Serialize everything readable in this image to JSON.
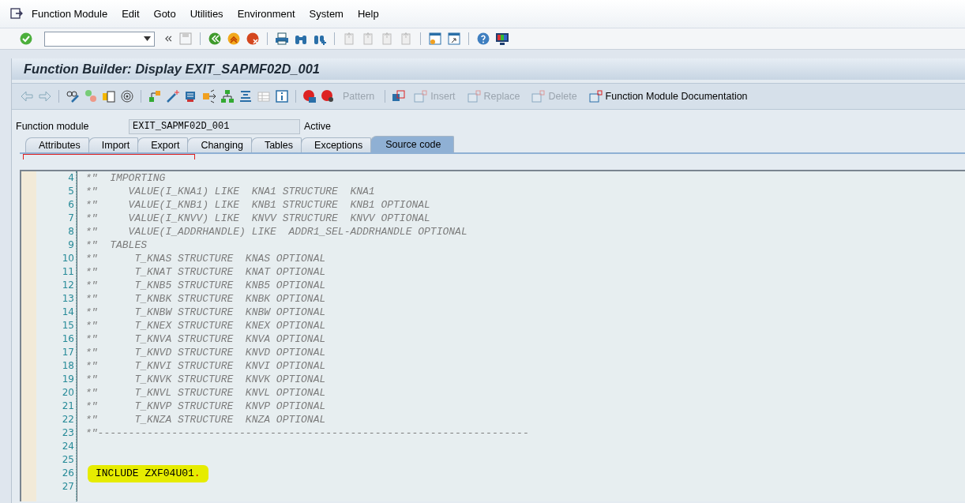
{
  "menu": [
    {
      "label": "Function Module"
    },
    {
      "label": "Edit"
    },
    {
      "label": "Goto"
    },
    {
      "label": "Utilities"
    },
    {
      "label": "Environment"
    },
    {
      "label": "System"
    },
    {
      "label": "Help"
    }
  ],
  "title": "Function Builder: Display EXIT_SAPMF02D_001",
  "app_toolbar": [
    {
      "label": "Pattern",
      "disabled": true
    },
    {
      "label": "Insert",
      "disabled": true
    },
    {
      "label": "Replace",
      "disabled": true
    },
    {
      "label": "Delete",
      "disabled": true
    },
    {
      "label": "Function Module Documentation",
      "disabled": false
    }
  ],
  "field": {
    "label": "Function module",
    "value": "EXIT_SAPMF02D_001",
    "status": "Active"
  },
  "tabs": [
    {
      "label": "Attributes",
      "selected": false
    },
    {
      "label": "Import",
      "selected": false
    },
    {
      "label": "Export",
      "selected": false
    },
    {
      "label": "Changing",
      "selected": false
    },
    {
      "label": "Tables",
      "selected": false
    },
    {
      "label": "Exceptions",
      "selected": false
    },
    {
      "label": "Source code",
      "selected": true
    }
  ],
  "editor": {
    "lines": [
      {
        "number": "4",
        "kind": "comment",
        "text": "*\"  IMPORTING"
      },
      {
        "number": "5",
        "kind": "comment",
        "text": "*\"     VALUE(I_KNA1) LIKE  KNA1 STRUCTURE  KNA1"
      },
      {
        "number": "6",
        "kind": "comment",
        "text": "*\"     VALUE(I_KNB1) LIKE  KNB1 STRUCTURE  KNB1 OPTIONAL"
      },
      {
        "number": "7",
        "kind": "comment",
        "text": "*\"     VALUE(I_KNVV) LIKE  KNVV STRUCTURE  KNVV OPTIONAL"
      },
      {
        "number": "8",
        "kind": "comment",
        "text": "*\"     VALUE(I_ADDRHANDLE) LIKE  ADDR1_SEL-ADDRHANDLE OPTIONAL"
      },
      {
        "number": "9",
        "kind": "comment",
        "text": "*\"  TABLES"
      },
      {
        "number": "10",
        "kind": "comment",
        "text": "*\"      T_KNAS STRUCTURE  KNAS OPTIONAL"
      },
      {
        "number": "11",
        "kind": "comment",
        "text": "*\"      T_KNAT STRUCTURE  KNAT OPTIONAL"
      },
      {
        "number": "12",
        "kind": "comment",
        "text": "*\"      T_KNB5 STRUCTURE  KNB5 OPTIONAL"
      },
      {
        "number": "13",
        "kind": "comment",
        "text": "*\"      T_KNBK STRUCTURE  KNBK OPTIONAL"
      },
      {
        "number": "14",
        "kind": "comment",
        "text": "*\"      T_KNBW STRUCTURE  KNBW OPTIONAL"
      },
      {
        "number": "15",
        "kind": "comment",
        "text": "*\"      T_KNEX STRUCTURE  KNEX OPTIONAL"
      },
      {
        "number": "16",
        "kind": "comment",
        "text": "*\"      T_KNVA STRUCTURE  KNVA OPTIONAL"
      },
      {
        "number": "17",
        "kind": "comment",
        "text": "*\"      T_KNVD STRUCTURE  KNVD OPTIONAL"
      },
      {
        "number": "18",
        "kind": "comment",
        "text": "*\"      T_KNVI STRUCTURE  KNVI OPTIONAL"
      },
      {
        "number": "19",
        "kind": "comment",
        "text": "*\"      T_KNVK STRUCTURE  KNVK OPTIONAL"
      },
      {
        "number": "20",
        "kind": "comment",
        "text": "*\"      T_KNVL STRUCTURE  KNVL OPTIONAL"
      },
      {
        "number": "21",
        "kind": "comment",
        "text": "*\"      T_KNVP STRUCTURE  KNVP OPTIONAL"
      },
      {
        "number": "22",
        "kind": "comment",
        "text": "*\"      T_KNZA STRUCTURE  KNZA OPTIONAL"
      },
      {
        "number": "23",
        "kind": "comment",
        "text": "*\"----------------------------------------------------------------------"
      },
      {
        "number": "24",
        "kind": "blank"
      },
      {
        "number": "25",
        "kind": "blank"
      },
      {
        "number": "26",
        "kind": "highlighted",
        "text": "INCLUDE ZXF04U01",
        "terminator": "."
      },
      {
        "number": "27",
        "kind": "blank"
      }
    ]
  }
}
